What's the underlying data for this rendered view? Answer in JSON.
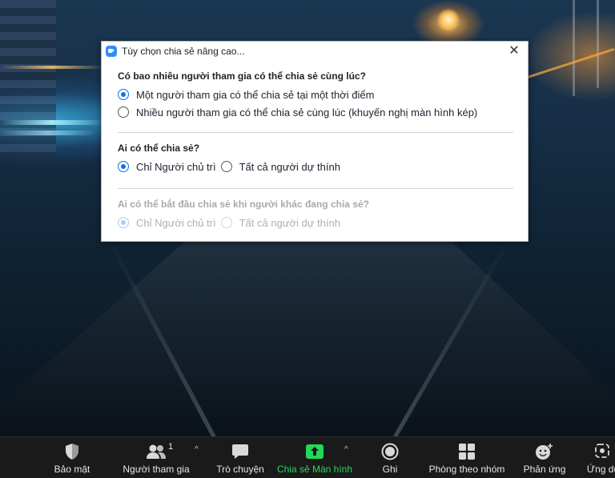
{
  "dialog": {
    "title": "Tùy chọn chia sẻ nâng cao...",
    "close_symbol": "✕",
    "sections": [
      {
        "heading": "Có bao nhiêu người tham gia có thể chia sẻ cùng lúc?",
        "options": [
          {
            "label": "Một người tham gia có thể chia sẻ tại một thời điểm",
            "checked": true
          },
          {
            "label": "Nhiều người tham gia có thể chia sẻ cùng lúc (khuyến nghị màn hình kép)",
            "checked": false
          }
        ]
      },
      {
        "heading": "Ai có thể chia sẻ?",
        "options": [
          {
            "label": "Chỉ Người chủ trì",
            "checked": true
          },
          {
            "label": "Tất cả người dự thính",
            "checked": false
          }
        ]
      },
      {
        "heading": "Ai có thể bắt đầu chia sẻ khi người khác đang chia sẻ?",
        "disabled": true,
        "options": [
          {
            "label": "Chỉ Người chủ trì",
            "checked": true
          },
          {
            "label": "Tất cả người dự thính",
            "checked": false
          }
        ]
      }
    ]
  },
  "toolbar": {
    "items": [
      {
        "label": "Bảo mật",
        "icon": "shield-icon"
      },
      {
        "label": "Người tham gia",
        "icon": "participants-icon",
        "count": "1",
        "caret": "^"
      },
      {
        "label": "Trò chuyện",
        "icon": "chat-icon"
      },
      {
        "label": "Chia sẻ Màn hình",
        "icon": "share-screen-icon",
        "caret": "^",
        "color": "#23d959"
      },
      {
        "label": "Ghi",
        "icon": "record-icon"
      },
      {
        "label": "Phòng theo nhóm",
        "icon": "breakout-rooms-icon"
      },
      {
        "label": "Phản ứng",
        "icon": "reactions-icon"
      },
      {
        "label": "Ứng dụ",
        "icon": "apps-icon"
      }
    ]
  },
  "colors": {
    "accent": "#0e72ed",
    "share_green": "#23d959",
    "toolbar_bg": "#1a1a1a"
  }
}
